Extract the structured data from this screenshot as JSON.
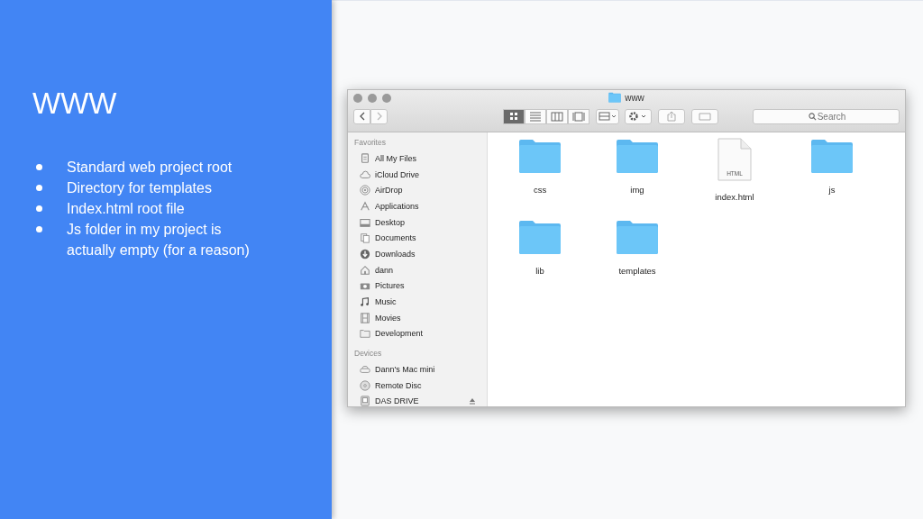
{
  "slide": {
    "title": "WWW",
    "bullets": [
      "Standard web project root",
      "Directory for templates",
      "Index.html root file",
      "Js folder in my project is actually empty (for a reason)"
    ]
  },
  "window": {
    "title": "www"
  },
  "toolbar": {
    "views": [
      {
        "selected": true
      },
      {
        "selected": false
      },
      {
        "selected": false
      },
      {
        "selected": false
      }
    ],
    "search": {
      "placeholder": "Search"
    }
  },
  "sidebar": {
    "sections": [
      {
        "heading": "Favorites",
        "items": [
          {
            "label": "All My Files",
            "selected": false
          },
          {
            "label": "iCloud Drive",
            "selected": false
          },
          {
            "label": "AirDrop",
            "selected": false
          },
          {
            "label": "Applications",
            "selected": false
          },
          {
            "label": "Desktop",
            "selected": false
          },
          {
            "label": "Documents",
            "selected": false
          },
          {
            "label": "Downloads",
            "selected": false
          },
          {
            "label": "dann",
            "selected": false
          },
          {
            "label": "Pictures",
            "selected": false
          },
          {
            "label": "Music",
            "selected": false
          },
          {
            "label": "Movies",
            "selected": false
          },
          {
            "label": "Development",
            "selected": false
          }
        ]
      },
      {
        "heading": "Devices",
        "items": [
          {
            "label": "Dann's Mac mini",
            "selected": false
          },
          {
            "label": "Remote Disc",
            "selected": false
          },
          {
            "label": "DAS DRIVE",
            "selected": false,
            "ejectable": true
          }
        ]
      }
    ]
  },
  "files": [
    {
      "kind": "folder",
      "name": "css"
    },
    {
      "kind": "folder",
      "name": "img"
    },
    {
      "kind": "file",
      "name": "index.html",
      "badge": "HTML"
    },
    {
      "kind": "folder",
      "name": "js"
    },
    {
      "kind": "folder",
      "name": "lib"
    },
    {
      "kind": "folder",
      "name": "templates"
    }
  ]
}
